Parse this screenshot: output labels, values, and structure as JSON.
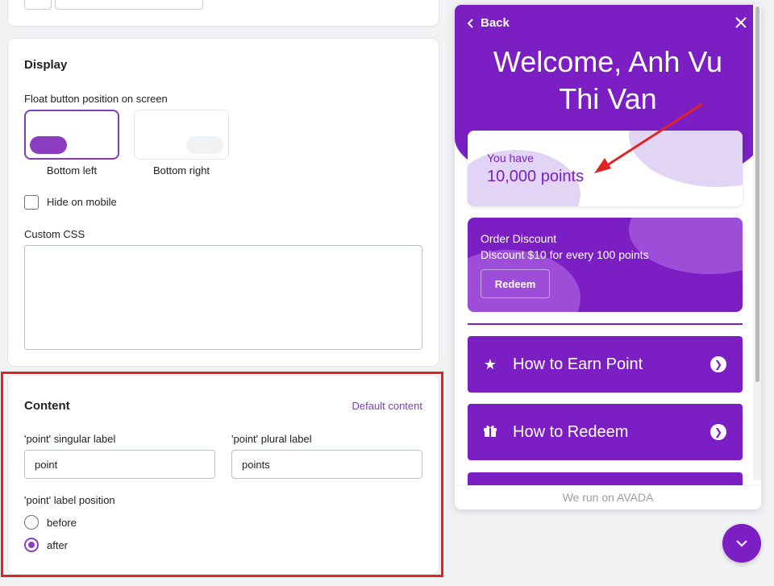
{
  "display": {
    "title": "Display",
    "float_label": "Float button position on screen",
    "bottom_left": "Bottom left",
    "bottom_right": "Bottom right",
    "hide_mobile": "Hide on mobile",
    "custom_css": "Custom CSS"
  },
  "content": {
    "title": "Content",
    "default_link": "Default content",
    "singular_label": "'point' singular label",
    "singular_value": "point",
    "plural_label": "'point' plural label",
    "plural_value": "points",
    "position_label": "'point' label position",
    "before": "before",
    "after": "after",
    "selected_position": "after"
  },
  "widget": {
    "back": "Back",
    "welcome": "Welcome, Anh Vu Thi Van",
    "you_have": "You have",
    "points": "10,000 points",
    "discount_title": "Order Discount",
    "discount_desc": "Discount $10 for every 100 points",
    "redeem": "Redeem",
    "earn": "How to Earn Point",
    "how_redeem": "How to Redeem",
    "footer": "We run on AVADA",
    "brand_color": "#7b1fc4"
  }
}
